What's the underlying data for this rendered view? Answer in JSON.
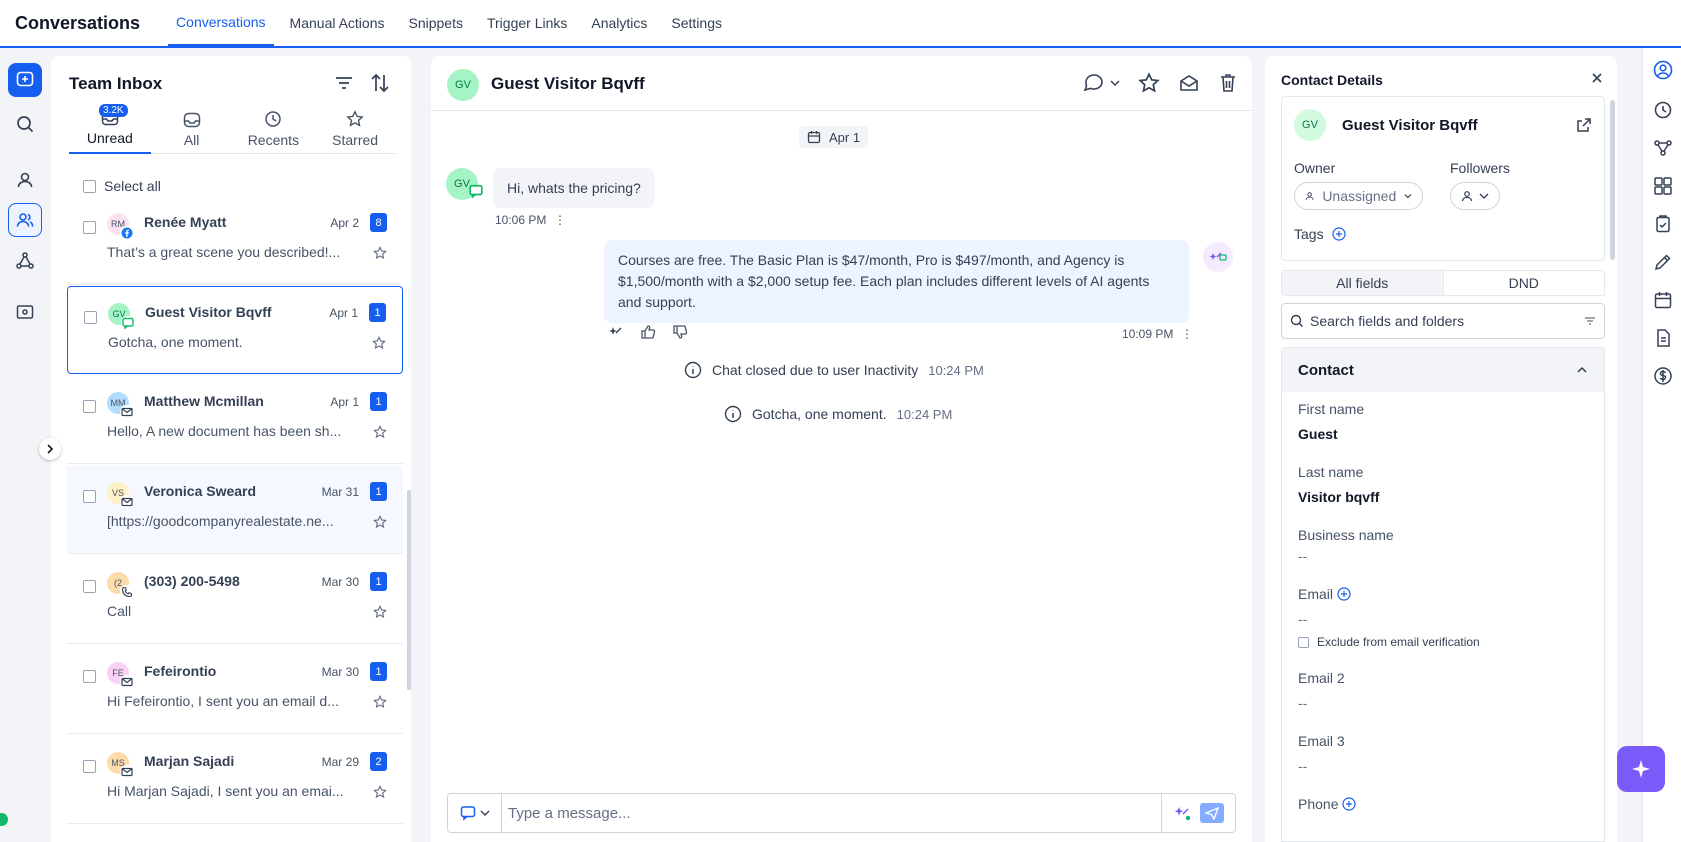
{
  "app": {
    "title": "Conversations",
    "nav": [
      "Conversations",
      "Manual Actions",
      "Snippets",
      "Trigger Links",
      "Analytics",
      "Settings"
    ]
  },
  "inbox": {
    "title": "Team Inbox",
    "tabs": [
      {
        "label": "Unread",
        "count": "3.2K"
      },
      {
        "label": "All"
      },
      {
        "label": "Recents"
      },
      {
        "label": "Starred"
      }
    ],
    "select_all": "Select all",
    "conversations": [
      {
        "initials": "RM",
        "name": "Renée Myatt",
        "date": "Apr 2",
        "badge": "8",
        "preview": "That’s a great scene you described!...",
        "avatar_color": "#fde2f3",
        "channel": "facebook"
      },
      {
        "initials": "GV",
        "name": "Guest Visitor Bqvff",
        "date": "Apr 1",
        "badge": "1",
        "preview": "Gotcha, one moment.",
        "avatar_color": "#a6f4c5",
        "channel": "chat"
      },
      {
        "initials": "MM",
        "name": "Matthew Mcmillan",
        "date": "Apr 1",
        "badge": "1",
        "preview": "Hello, A new document has been sh...",
        "avatar_color": "#b2ddff",
        "channel": "email"
      },
      {
        "initials": "VS",
        "name": "Veronica Sweard",
        "date": "Mar 31",
        "badge": "1",
        "preview": "[https://goodcompanyrealestate.ne...",
        "avatar_color": "#fef0c7",
        "channel": "email"
      },
      {
        "initials": "(2",
        "name": "(303) 200-5498",
        "date": "Mar 30",
        "badge": "1",
        "preview": "Call",
        "avatar_color": "#fddcab",
        "channel": "phone"
      },
      {
        "initials": "FE",
        "name": "Fefeirontio",
        "date": "Mar 30",
        "badge": "1",
        "preview": "Hi Fefeirontio, I sent you an email d...",
        "avatar_color": "#fbd2f5",
        "channel": "email"
      },
      {
        "initials": "MS",
        "name": "Marjan Sajadi",
        "date": "Mar 29",
        "badge": "2",
        "preview": "Hi Marjan Sajadi, I sent you an emai...",
        "avatar_color": "#fddcab",
        "channel": "email"
      }
    ]
  },
  "chat": {
    "initials": "GV",
    "title": "Guest Visitor Bqvff",
    "date_divider": "Apr 1",
    "incoming": {
      "text": "Hi, whats the pricing?",
      "time": "10:06 PM"
    },
    "outgoing": {
      "text": "Courses are free. The Basic Plan is $47/month, Pro is $497/month, and Agency is $1,500/month with a $2,000 setup fee. Each plan includes different levels of AI agents and support.",
      "time": "10:09 PM"
    },
    "system": [
      {
        "text": "Chat closed due to user Inactivity",
        "time": "10:24 PM"
      },
      {
        "text": "Gotcha, one moment.",
        "time": "10:24 PM"
      }
    ],
    "composer_placeholder": "Type a message..."
  },
  "details": {
    "title": "Contact Details",
    "initials": "GV",
    "name": "Guest Visitor Bqvff",
    "owner_label": "Owner",
    "owner_value": "Unassigned",
    "followers_label": "Followers",
    "tags_label": "Tags",
    "seg_all": "All fields",
    "seg_dnd": "DND",
    "search_placeholder": "Search fields and folders",
    "section_title": "Contact",
    "fields": {
      "first_name_label": "First name",
      "first_name": "Guest",
      "last_name_label": "Last name",
      "last_name": "Visitor bqvff",
      "business_label": "Business name",
      "business": "--",
      "email_label": "Email",
      "email": "--",
      "exclude_label": "Exclude from email verification",
      "email2_label": "Email 2",
      "email2": "--",
      "email3_label": "Email 3",
      "email3": "--",
      "phone_label": "Phone"
    }
  },
  "colors": {
    "accent": "#155eef",
    "ai": "#7a5af8"
  }
}
